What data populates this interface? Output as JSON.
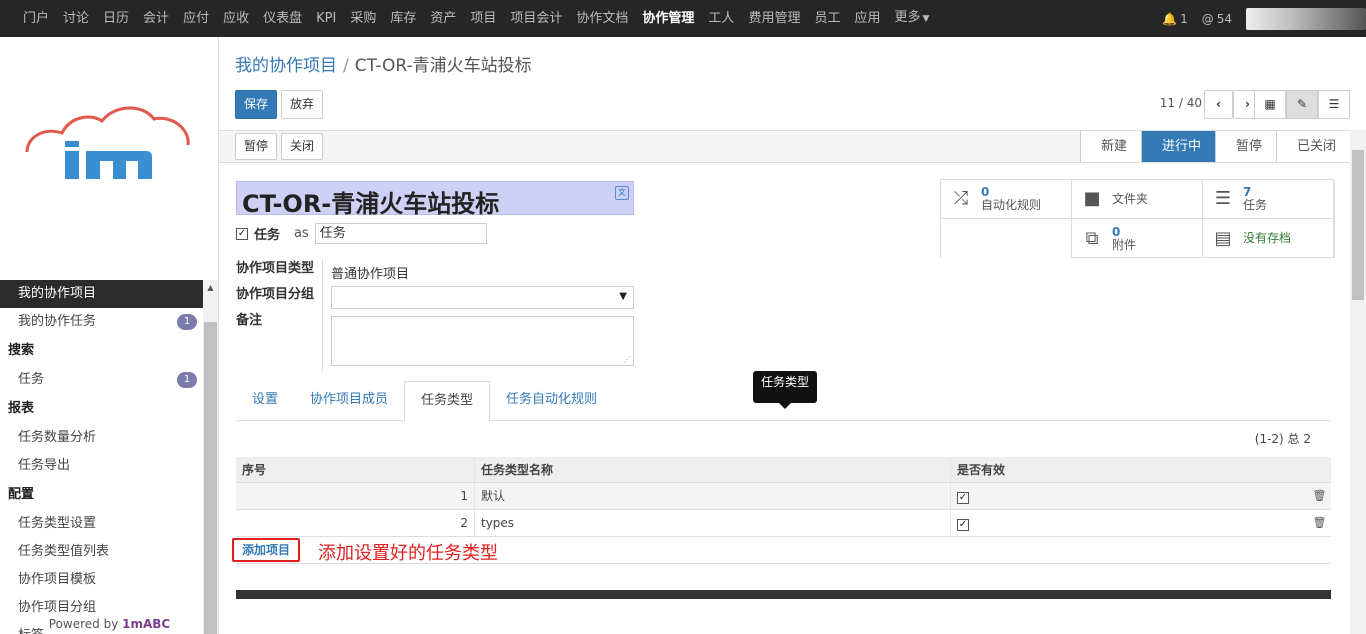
{
  "topnav": {
    "menus": [
      "门户",
      "讨论",
      "日历",
      "会计",
      "应付",
      "应收",
      "仪表盘",
      "KPI",
      "采购",
      "库存",
      "资产",
      "项目",
      "项目会计",
      "协作文档",
      "协作管理",
      "工人",
      "费用管理",
      "员工",
      "应用"
    ],
    "active": "协作管理",
    "more": "更多",
    "notifications": "1",
    "mentions": "54"
  },
  "sidebar": {
    "items": [
      {
        "label": "我的协作项目",
        "active": true
      },
      {
        "label": "我的协作任务",
        "badge": "1"
      }
    ],
    "search_section": "搜索",
    "search_items": [
      {
        "label": "任务",
        "badge": "1"
      }
    ],
    "report_section": "报表",
    "report_items": [
      "任务数量分析",
      "任务导出"
    ],
    "config_section": "配置",
    "config_items": [
      "任务类型设置",
      "任务类型值列表",
      "协作项目模板",
      "协作项目分组",
      "标签"
    ],
    "powered_prefix": "Powered by ",
    "powered_brand": "1mABC"
  },
  "breadcrumb": {
    "parent": "我的协作项目",
    "sep": "/",
    "current": "CT-OR-青浦火车站投标"
  },
  "toolbar": {
    "save": "保存",
    "discard": "放弃",
    "pager": "11 / 40"
  },
  "status": {
    "buttons": [
      "暂停",
      "关闭"
    ],
    "stages": [
      "新建",
      "进行中",
      "暂停",
      "已关闭"
    ],
    "current_stage": "进行中"
  },
  "form": {
    "title": "CT-OR-青浦火车站投标",
    "task_label": "任务",
    "as_label": "as",
    "task_alias": "任务",
    "fields": {
      "type_label": "协作项目类型",
      "type_value": "普通协作项目",
      "group_label": "协作项目分组",
      "note_label": "备注"
    },
    "smart_buttons": [
      {
        "num": "0",
        "label": "自动化规则",
        "icon": "shuffle-icon"
      },
      {
        "num": "",
        "label": "文件夹",
        "icon": "folder-icon"
      },
      {
        "num": "7",
        "label": "任务",
        "icon": "tasks-icon"
      },
      {
        "num": "0",
        "label": "附件",
        "icon": "files-icon"
      },
      {
        "num": "",
        "label": "没有存档",
        "icon": "archive-icon"
      }
    ]
  },
  "tabs": [
    "设置",
    "协作项目成员",
    "任务类型",
    "任务自动化规则"
  ],
  "active_tab": "任务类型",
  "tooltip": "任务类型",
  "grid": {
    "count": "(1-2) 总 2",
    "headers": [
      "序号",
      "任务类型名称",
      "是否有效"
    ],
    "rows": [
      {
        "seq": "1",
        "name": "默认",
        "active": true
      },
      {
        "seq": "2",
        "name": "types",
        "active": true
      }
    ],
    "add_label": "添加项目",
    "annotation": "添加设置好的任务类型"
  }
}
